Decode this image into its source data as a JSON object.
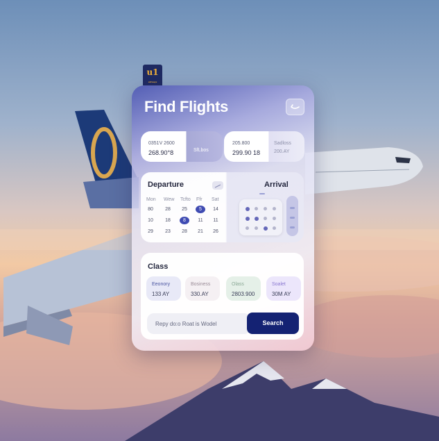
{
  "app": {
    "brand_mark": "u1",
    "brand_subtext": "airways",
    "title": "Find Flights"
  },
  "route": {
    "from": {
      "code_line": "0351V 2600",
      "value_line": "268.90°8",
      "badge": "SfLbos"
    },
    "to": {
      "code_line": "205.800",
      "value_line": "299.90 18",
      "sub_line": "Sadloss",
      "badge": "200.AY"
    }
  },
  "dates": {
    "departure_label": "Departure",
    "arrival_label": "Arrival",
    "weekdays": [
      "Mon",
      "Wew",
      "Tcfto",
      "Ffr",
      "Sat"
    ],
    "rows": [
      [
        "80",
        "28",
        "25",
        "5",
        "14"
      ],
      [
        "10",
        "18",
        "8",
        "11",
        "11"
      ],
      [
        "29",
        "23",
        "28",
        "21",
        "26"
      ]
    ],
    "selected": [
      [
        0,
        3
      ],
      [
        1,
        2
      ]
    ]
  },
  "class_section": {
    "label": "Class",
    "options": [
      {
        "name": "Eeonory",
        "price": "133 AY",
        "bg": "#e8e9f7",
        "name_color": "#4a55a0"
      },
      {
        "name": "Bosiness",
        "price": "330.AY",
        "bg": "#f5f0f3",
        "name_color": "#9a8c97"
      },
      {
        "name": "Olass",
        "price": "2803.900",
        "bg": "#e5f0e8",
        "name_color": "#8aa895"
      },
      {
        "name": "Soalet",
        "price": "30M AY",
        "bg": "#ece6fb",
        "name_color": "#8a78d0"
      }
    ]
  },
  "search": {
    "input_text": "Repy do:o Roat is Wodel",
    "button_label": "Search"
  },
  "colors": {
    "accent": "#3f4bb2",
    "button": "#142273"
  }
}
